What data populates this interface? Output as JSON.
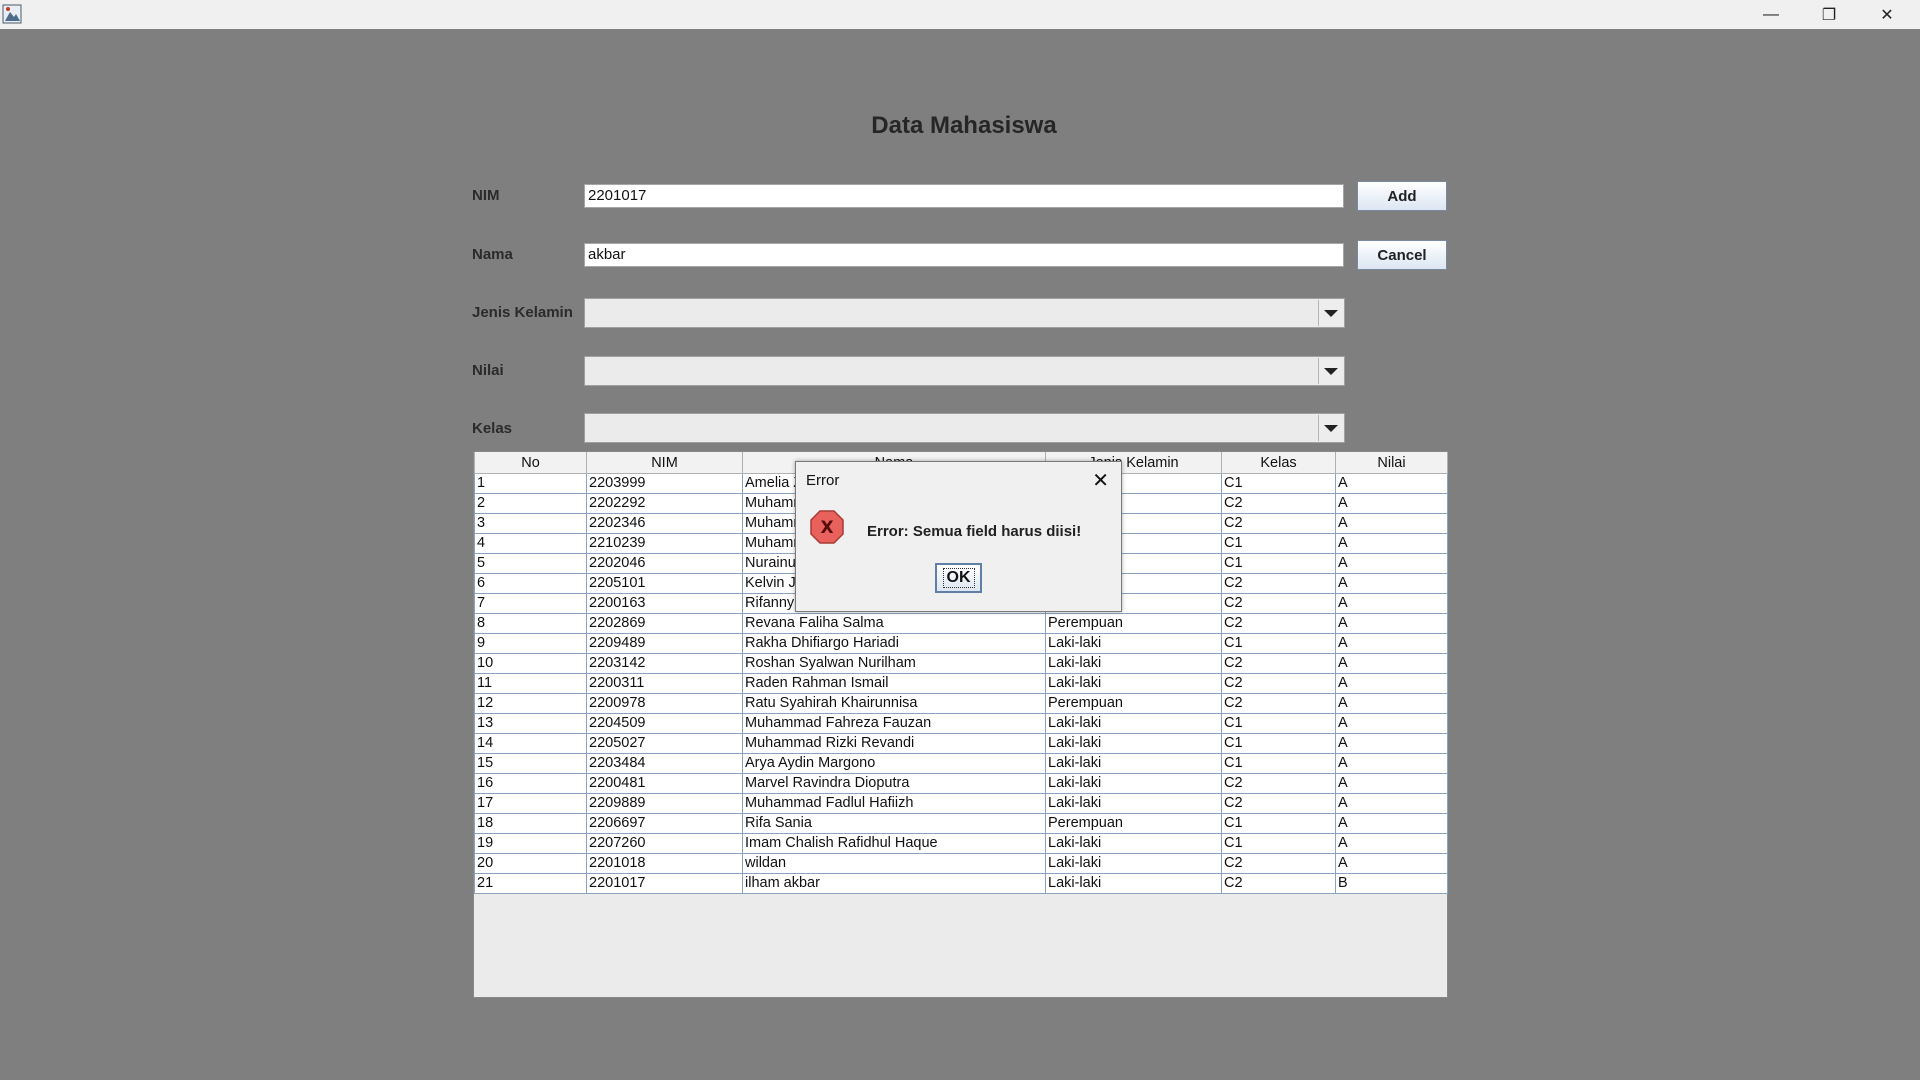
{
  "window": {
    "minimize_glyph": "—",
    "restore_glyph": "❐",
    "close_glyph": "✕"
  },
  "page_title": "Data Mahasiswa",
  "form": {
    "nim_label": "NIM",
    "nim_value": "2201017",
    "nama_label": "Nama",
    "nama_value": "akbar",
    "jenis_kelamin_label": "Jenis Kelamin",
    "jenis_kelamin_value": "",
    "nilai_label": "Nilai",
    "nilai_value": "",
    "kelas_label": "Kelas",
    "kelas_value": ""
  },
  "buttons": {
    "add": "Add",
    "cancel": "Cancel"
  },
  "table": {
    "headers": [
      "No",
      "NIM",
      "Nama",
      "Jenis Kelamin",
      "Kelas",
      "Nilai"
    ],
    "rows": [
      [
        "1",
        "2203999",
        "Amelia Z",
        "",
        "C1",
        "A"
      ],
      [
        "2",
        "2202292",
        "Muhamm",
        "",
        "C2",
        "A"
      ],
      [
        "3",
        "2202346",
        "Muhamm",
        "",
        "C2",
        "A"
      ],
      [
        "4",
        "2210239",
        "Muhamm",
        "",
        "C1",
        "A"
      ],
      [
        "5",
        "2202046",
        "Nurainur",
        "",
        "C1",
        "A"
      ],
      [
        "6",
        "2205101",
        "Kelvin Ju",
        "",
        "C2",
        "A"
      ],
      [
        "7",
        "2200163",
        "Rifanny",
        "",
        "C2",
        "A"
      ],
      [
        "8",
        "2202869",
        "Revana Faliha Salma",
        "Perempuan",
        "C2",
        "A"
      ],
      [
        "9",
        "2209489",
        "Rakha Dhifiargo Hariadi",
        "Laki-laki",
        "C1",
        "A"
      ],
      [
        "10",
        "2203142",
        "Roshan Syalwan Nurilham",
        "Laki-laki",
        "C2",
        "A"
      ],
      [
        "11",
        "2200311",
        "Raden Rahman Ismail",
        "Laki-laki",
        "C2",
        "A"
      ],
      [
        "12",
        "2200978",
        "Ratu Syahirah Khairunnisa",
        "Perempuan",
        "C2",
        "A"
      ],
      [
        "13",
        "2204509",
        "Muhammad Fahreza Fauzan",
        "Laki-laki",
        "C1",
        "A"
      ],
      [
        "14",
        "2205027",
        "Muhammad Rizki Revandi",
        "Laki-laki",
        "C1",
        "A"
      ],
      [
        "15",
        "2203484",
        "Arya Aydin Margono",
        "Laki-laki",
        "C1",
        "A"
      ],
      [
        "16",
        "2200481",
        "Marvel Ravindra Dioputra",
        "Laki-laki",
        "C2",
        "A"
      ],
      [
        "17",
        "2209889",
        "Muhammad Fadlul Hafiizh",
        "Laki-laki",
        "C2",
        "A"
      ],
      [
        "18",
        "2206697",
        "Rifa Sania",
        "Perempuan",
        "C1",
        "A"
      ],
      [
        "19",
        "2207260",
        "Imam Chalish Rafidhul Haque",
        "Laki-laki",
        "C1",
        "A"
      ],
      [
        "20",
        "2201018",
        "wildan",
        "Laki-laki",
        "C2",
        "A"
      ],
      [
        "21",
        "2201017",
        "ilham akbar",
        "Laki-laki",
        "C2",
        "B"
      ]
    ]
  },
  "dialog": {
    "title": "Error",
    "message": "Error: Semua field harus diisi!",
    "ok_label": "OK",
    "close_glyph": "✕"
  },
  "colors": {
    "backdrop": "#7f7f7f",
    "error_icon": "#d9534f",
    "button_border": "#7a8a9e"
  }
}
